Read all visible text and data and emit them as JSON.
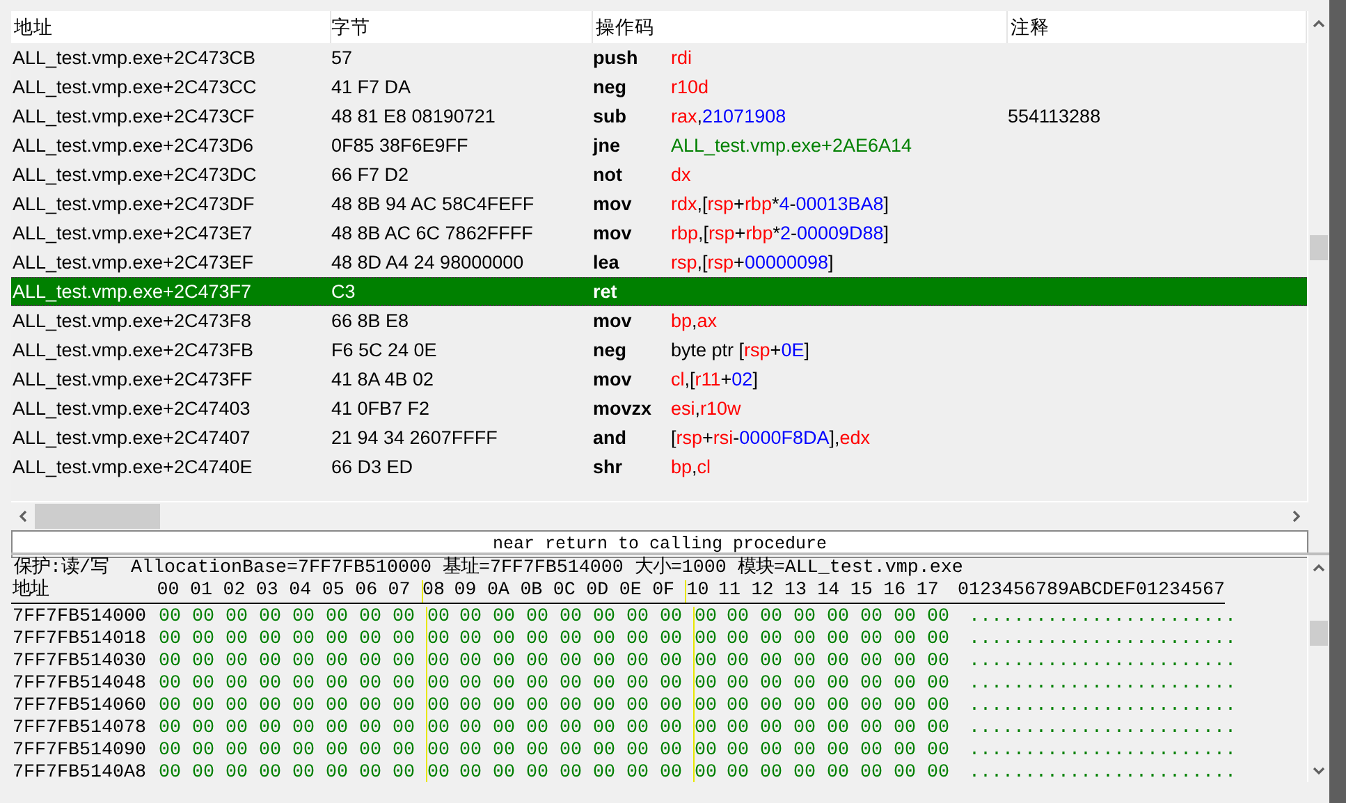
{
  "disassembly": {
    "columns": [
      "地址",
      "字节",
      "操作码",
      "注释"
    ],
    "rows": [
      {
        "address": "ALL_test.vmp.exe+2C473CB",
        "bytes": "57",
        "opcode": "push",
        "operand": [
          {
            "kind": "reg",
            "text": "rdi"
          }
        ],
        "comment": "",
        "selected": false
      },
      {
        "address": "ALL_test.vmp.exe+2C473CC",
        "bytes": "41 F7 DA",
        "opcode": "neg",
        "operand": [
          {
            "kind": "reg",
            "text": "r10d"
          }
        ],
        "comment": "",
        "selected": false
      },
      {
        "address": "ALL_test.vmp.exe+2C473CF",
        "bytes": "48 81 E8 08190721",
        "opcode": "sub",
        "operand": [
          {
            "kind": "reg",
            "text": "rax"
          },
          {
            "kind": "sym",
            "text": ","
          },
          {
            "kind": "num",
            "text": "21071908"
          }
        ],
        "comment": "554113288",
        "selected": false
      },
      {
        "address": "ALL_test.vmp.exe+2C473D6",
        "bytes": "0F85 38F6E9FF",
        "opcode": "jne",
        "operand": [
          {
            "kind": "addr",
            "text": "ALL_test.vmp.exe+2AE6A14"
          }
        ],
        "comment": "",
        "selected": false
      },
      {
        "address": "ALL_test.vmp.exe+2C473DC",
        "bytes": "66 F7 D2",
        "opcode": "not",
        "operand": [
          {
            "kind": "reg",
            "text": "dx"
          }
        ],
        "comment": "",
        "selected": false
      },
      {
        "address": "ALL_test.vmp.exe+2C473DF",
        "bytes": "48 8B 94 AC 58C4FEFF",
        "opcode": "mov",
        "operand": [
          {
            "kind": "reg",
            "text": "rdx"
          },
          {
            "kind": "sym",
            "text": ",["
          },
          {
            "kind": "reg",
            "text": "rsp"
          },
          {
            "kind": "sym",
            "text": "+"
          },
          {
            "kind": "reg",
            "text": "rbp"
          },
          {
            "kind": "sym",
            "text": "*"
          },
          {
            "kind": "num",
            "text": "4"
          },
          {
            "kind": "sym",
            "text": "-"
          },
          {
            "kind": "num",
            "text": "00013BA8"
          },
          {
            "kind": "sym",
            "text": "]"
          }
        ],
        "comment": "",
        "selected": false
      },
      {
        "address": "ALL_test.vmp.exe+2C473E7",
        "bytes": "48 8B AC 6C 7862FFFF",
        "opcode": "mov",
        "operand": [
          {
            "kind": "reg",
            "text": "rbp"
          },
          {
            "kind": "sym",
            "text": ",["
          },
          {
            "kind": "reg",
            "text": "rsp"
          },
          {
            "kind": "sym",
            "text": "+"
          },
          {
            "kind": "reg",
            "text": "rbp"
          },
          {
            "kind": "sym",
            "text": "*"
          },
          {
            "kind": "num",
            "text": "2"
          },
          {
            "kind": "sym",
            "text": "-"
          },
          {
            "kind": "num",
            "text": "00009D88"
          },
          {
            "kind": "sym",
            "text": "]"
          }
        ],
        "comment": "",
        "selected": false
      },
      {
        "address": "ALL_test.vmp.exe+2C473EF",
        "bytes": "48 8D A4 24 98000000",
        "opcode": "lea",
        "operand": [
          {
            "kind": "reg",
            "text": "rsp"
          },
          {
            "kind": "sym",
            "text": ",["
          },
          {
            "kind": "reg",
            "text": "rsp"
          },
          {
            "kind": "sym",
            "text": "+"
          },
          {
            "kind": "num",
            "text": "00000098"
          },
          {
            "kind": "sym",
            "text": "]"
          }
        ],
        "comment": "",
        "selected": false
      },
      {
        "address": "ALL_test.vmp.exe+2C473F7",
        "bytes": "C3",
        "opcode": "ret",
        "operand": [],
        "comment": "",
        "selected": true
      },
      {
        "address": "ALL_test.vmp.exe+2C473F8",
        "bytes": "66 8B E8",
        "opcode": "mov",
        "operand": [
          {
            "kind": "reg",
            "text": "bp"
          },
          {
            "kind": "sym",
            "text": ","
          },
          {
            "kind": "reg",
            "text": "ax"
          }
        ],
        "comment": "",
        "selected": false
      },
      {
        "address": "ALL_test.vmp.exe+2C473FB",
        "bytes": "F6 5C 24 0E",
        "opcode": "neg",
        "operand": [
          {
            "kind": "sym",
            "text": "byte ptr ["
          },
          {
            "kind": "reg",
            "text": "rsp"
          },
          {
            "kind": "sym",
            "text": "+"
          },
          {
            "kind": "num",
            "text": "0E"
          },
          {
            "kind": "sym",
            "text": "]"
          }
        ],
        "comment": "",
        "selected": false
      },
      {
        "address": "ALL_test.vmp.exe+2C473FF",
        "bytes": "41 8A 4B 02",
        "opcode": "mov",
        "operand": [
          {
            "kind": "reg",
            "text": "cl"
          },
          {
            "kind": "sym",
            "text": ",["
          },
          {
            "kind": "reg",
            "text": "r11"
          },
          {
            "kind": "sym",
            "text": "+"
          },
          {
            "kind": "num",
            "text": "02"
          },
          {
            "kind": "sym",
            "text": "]"
          }
        ],
        "comment": "",
        "selected": false
      },
      {
        "address": "ALL_test.vmp.exe+2C47403",
        "bytes": "41 0FB7 F2",
        "opcode": "movzx",
        "operand": [
          {
            "kind": "reg",
            "text": "esi"
          },
          {
            "kind": "sym",
            "text": ","
          },
          {
            "kind": "reg",
            "text": "r10w"
          }
        ],
        "comment": "",
        "selected": false
      },
      {
        "address": "ALL_test.vmp.exe+2C47407",
        "bytes": "21 94 34 2607FFFF",
        "opcode": "and",
        "operand": [
          {
            "kind": "sym",
            "text": "["
          },
          {
            "kind": "reg",
            "text": "rsp"
          },
          {
            "kind": "sym",
            "text": "+"
          },
          {
            "kind": "reg",
            "text": "rsi"
          },
          {
            "kind": "sym",
            "text": "-"
          },
          {
            "kind": "num",
            "text": "0000F8DA"
          },
          {
            "kind": "sym",
            "text": "],"
          },
          {
            "kind": "reg",
            "text": "edx"
          }
        ],
        "comment": "",
        "selected": false
      },
      {
        "address": "ALL_test.vmp.exe+2C4740E",
        "bytes": "66 D3 ED",
        "opcode": "shr",
        "operand": [
          {
            "kind": "reg",
            "text": "bp"
          },
          {
            "kind": "sym",
            "text": ","
          },
          {
            "kind": "reg",
            "text": "cl"
          }
        ],
        "comment": "",
        "selected": false
      }
    ],
    "description": "near return to calling procedure"
  },
  "hex_view": {
    "info": "保护:读/写  AllocationBase=7FF7FB510000 基址=7FF7FB514000 大小=1000 模块=ALL_test.vmp.exe",
    "address_header": "地址",
    "columns": [
      "00",
      "01",
      "02",
      "03",
      "04",
      "05",
      "06",
      "07",
      "08",
      "09",
      "0A",
      "0B",
      "0C",
      "0D",
      "0E",
      "0F",
      "10",
      "11",
      "12",
      "13",
      "14",
      "15",
      "16",
      "17"
    ],
    "ascii_header": "0123456789ABCDEF01234567",
    "rows": [
      {
        "address": "7FF7FB514000",
        "bytes": [
          "00",
          "00",
          "00",
          "00",
          "00",
          "00",
          "00",
          "00",
          "00",
          "00",
          "00",
          "00",
          "00",
          "00",
          "00",
          "00",
          "00",
          "00",
          "00",
          "00",
          "00",
          "00",
          "00",
          "00"
        ],
        "ascii": "........................"
      },
      {
        "address": "7FF7FB514018",
        "bytes": [
          "00",
          "00",
          "00",
          "00",
          "00",
          "00",
          "00",
          "00",
          "00",
          "00",
          "00",
          "00",
          "00",
          "00",
          "00",
          "00",
          "00",
          "00",
          "00",
          "00",
          "00",
          "00",
          "00",
          "00"
        ],
        "ascii": "........................"
      },
      {
        "address": "7FF7FB514030",
        "bytes": [
          "00",
          "00",
          "00",
          "00",
          "00",
          "00",
          "00",
          "00",
          "00",
          "00",
          "00",
          "00",
          "00",
          "00",
          "00",
          "00",
          "00",
          "00",
          "00",
          "00",
          "00",
          "00",
          "00",
          "00"
        ],
        "ascii": "........................"
      },
      {
        "address": "7FF7FB514048",
        "bytes": [
          "00",
          "00",
          "00",
          "00",
          "00",
          "00",
          "00",
          "00",
          "00",
          "00",
          "00",
          "00",
          "00",
          "00",
          "00",
          "00",
          "00",
          "00",
          "00",
          "00",
          "00",
          "00",
          "00",
          "00"
        ],
        "ascii": "........................"
      },
      {
        "address": "7FF7FB514060",
        "bytes": [
          "00",
          "00",
          "00",
          "00",
          "00",
          "00",
          "00",
          "00",
          "00",
          "00",
          "00",
          "00",
          "00",
          "00",
          "00",
          "00",
          "00",
          "00",
          "00",
          "00",
          "00",
          "00",
          "00",
          "00"
        ],
        "ascii": "........................"
      },
      {
        "address": "7FF7FB514078",
        "bytes": [
          "00",
          "00",
          "00",
          "00",
          "00",
          "00",
          "00",
          "00",
          "00",
          "00",
          "00",
          "00",
          "00",
          "00",
          "00",
          "00",
          "00",
          "00",
          "00",
          "00",
          "00",
          "00",
          "00",
          "00"
        ],
        "ascii": "........................"
      },
      {
        "address": "7FF7FB514090",
        "bytes": [
          "00",
          "00",
          "00",
          "00",
          "00",
          "00",
          "00",
          "00",
          "00",
          "00",
          "00",
          "00",
          "00",
          "00",
          "00",
          "00",
          "00",
          "00",
          "00",
          "00",
          "00",
          "00",
          "00",
          "00"
        ],
        "ascii": "........................"
      },
      {
        "address": "7FF7FB5140A8",
        "bytes": [
          "00",
          "00",
          "00",
          "00",
          "00",
          "00",
          "00",
          "00",
          "00",
          "00",
          "00",
          "00",
          "00",
          "00",
          "00",
          "00",
          "00",
          "00",
          "00",
          "00",
          "00",
          "00",
          "00",
          "00"
        ],
        "ascii": "........................"
      }
    ]
  }
}
